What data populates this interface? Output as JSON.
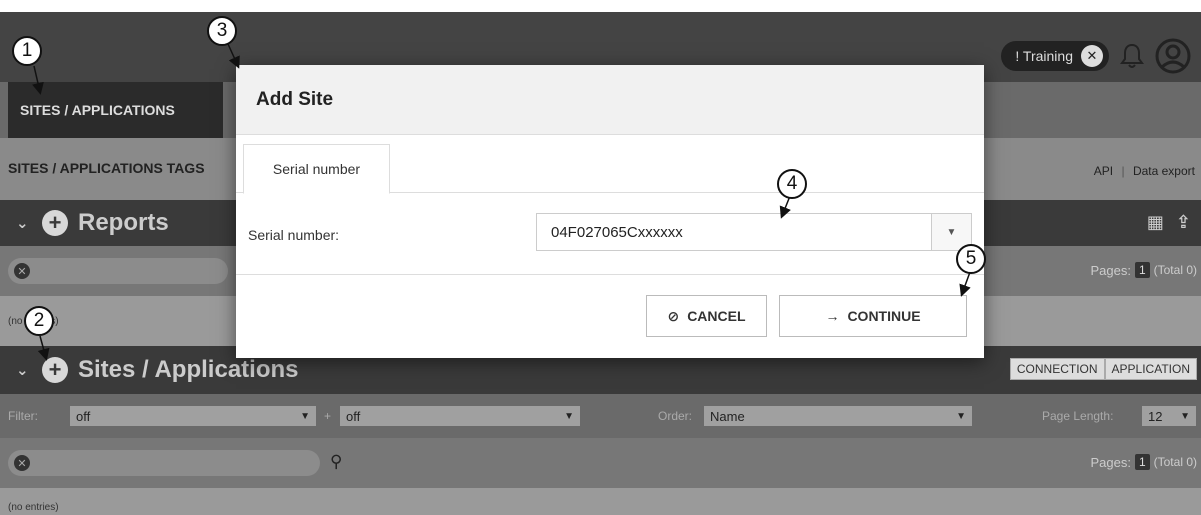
{
  "header": {
    "training_label": "! Training",
    "training_close": "✕",
    "bell_icon": "bell-icon",
    "user_icon": "user-icon"
  },
  "nav": {
    "active_tab": "SITES / APPLICATIONS"
  },
  "subbar": {
    "tabs_label": "SITES / APPLICATIONS TAGS",
    "link_api": "API",
    "link_sep": "|",
    "link_export": "Data export"
  },
  "reports": {
    "title": "Reports",
    "pages_label": "Pages:",
    "page_num": "1",
    "total": "(Total 0)",
    "entries": "(no entries)"
  },
  "sites": {
    "title": "Sites / Applications",
    "btn_connection": "CONNECTION",
    "btn_application": "APPLICATION",
    "filter_label": "Filter:",
    "filter1": "off",
    "plus": "+",
    "filter2": "off",
    "order_label": "Order:",
    "order_value": "Name",
    "pagelen_label": "Page Length:",
    "pagelen_value": "12",
    "pages_label": "Pages:",
    "page_num": "1",
    "total": "(Total 0)",
    "entries": "(no entries)"
  },
  "modal": {
    "title": "Add Site",
    "tab": "Serial number",
    "field_label": "Serial number:",
    "field_value": "04F027065Cxxxxxx",
    "cancel": "CANCEL",
    "continue": "CONTINUE"
  },
  "callouts": [
    "1",
    "2",
    "3",
    "4",
    "5"
  ],
  "colors": {
    "topbar": "#444444",
    "section": "#3a3a3a",
    "modal_header": "#f1f1f1"
  }
}
